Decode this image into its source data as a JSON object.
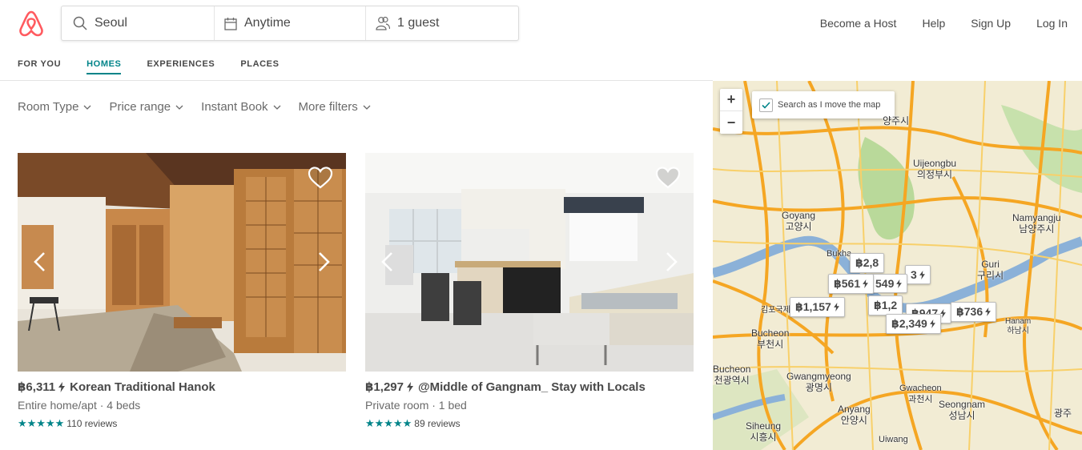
{
  "brand": {
    "color": "#FF5A5F",
    "accent": "#008489"
  },
  "search": {
    "location": "Seoul",
    "dates": "Anytime",
    "guests": "1 guest"
  },
  "topnav": {
    "become_host": "Become a Host",
    "help": "Help",
    "sign_up": "Sign Up",
    "log_in": "Log In"
  },
  "tabs": [
    {
      "label": "FOR YOU",
      "active": false
    },
    {
      "label": "HOMES",
      "active": true
    },
    {
      "label": "EXPERIENCES",
      "active": false
    },
    {
      "label": "PLACES",
      "active": false
    }
  ],
  "filters": [
    {
      "label": "Room Type"
    },
    {
      "label": "Price range"
    },
    {
      "label": "Instant Book"
    },
    {
      "label": "More filters"
    }
  ],
  "listings": [
    {
      "price": "฿6,311",
      "title": "Korean Traditional Hanok",
      "subtitle": "Entire home/apt · 4 beds",
      "stars": "★★★★★",
      "reviews": "110 reviews"
    },
    {
      "price": "฿1,297",
      "title": "@Middle of Gangnam_ Stay with Locals",
      "subtitle": "Private room · 1 bed",
      "stars": "★★★★★",
      "reviews": "89 reviews"
    }
  ],
  "map": {
    "zoom_in": "+",
    "zoom_out": "−",
    "search_as_move": "Search as I move the map",
    "search_as_move_checked": true,
    "pins": [
      {
        "label": "฿2,8"
      },
      {
        "label": "฿561"
      },
      {
        "label": "549"
      },
      {
        "label": "3"
      },
      {
        "label": "฿1,157"
      },
      {
        "label": "฿1,2"
      },
      {
        "label": "฿947"
      },
      {
        "label": "฿736"
      },
      {
        "label": "฿2,349"
      }
    ],
    "places": [
      {
        "en": "",
        "ko": "양주시"
      },
      {
        "en": "Uijeongbu",
        "ko": "의정부시"
      },
      {
        "en": "Goyang",
        "ko": "고양시"
      },
      {
        "en": "Namyangju",
        "ko": "남양주시"
      },
      {
        "en": "Guri",
        "ko": "구리시"
      },
      {
        "en": "Bucheon",
        "ko": "부천시"
      },
      {
        "en": "Hanam",
        "ko": "하남시"
      },
      {
        "en": "Gwangmyeong",
        "ko": "광명시"
      },
      {
        "en": "Gwacheon",
        "ko": "과천시"
      },
      {
        "en": "Anyang",
        "ko": "안양시"
      },
      {
        "en": "Seongnam",
        "ko": "성남시"
      },
      {
        "en": "Siheung",
        "ko": "시흥시"
      },
      {
        "en": "Uiwang",
        "ko": ""
      },
      {
        "en": "Bucheon",
        "ko": "천광역시"
      },
      {
        "en": "",
        "ko": "김포국제"
      },
      {
        "en": "Bukha",
        "ko": ""
      },
      {
        "en": "",
        "ko": "광주"
      }
    ]
  }
}
